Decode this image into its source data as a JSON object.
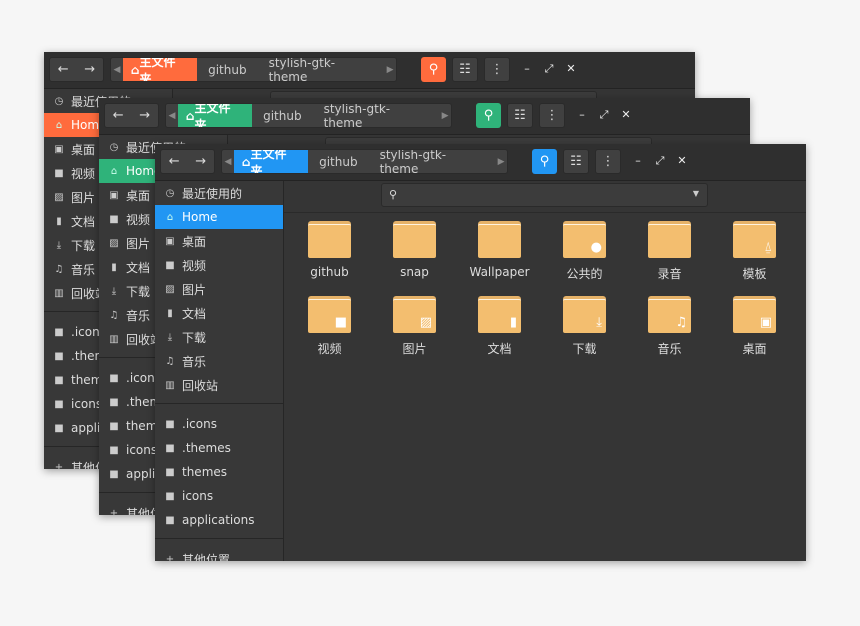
{
  "windows": [
    {
      "accent": "#ff6b3d",
      "nav": {
        "back": "←",
        "forward": "→"
      },
      "breadcrumbs": [
        "主文件夹",
        "github",
        "stylish-gtk-theme"
      ]
    },
    {
      "accent": "#2fb37a",
      "nav": {
        "back": "←",
        "forward": "→"
      },
      "breadcrumbs": [
        "主文件夹",
        "github",
        "stylish-gtk-theme"
      ]
    },
    {
      "accent": "#2196f3",
      "nav": {
        "back": "←",
        "forward": "→"
      },
      "breadcrumbs": [
        "主文件夹",
        "github",
        "stylish-gtk-theme"
      ]
    }
  ],
  "window_controls": {
    "minimize": "–",
    "maximize": "⤢",
    "close": "✕"
  },
  "sidebar": {
    "places": [
      {
        "label": "最近使用的",
        "icon": "clock-icon"
      },
      {
        "label": "Home",
        "icon": "home-icon",
        "active": true
      },
      {
        "label": "桌面",
        "icon": "desktop-icon"
      },
      {
        "label": "视频",
        "icon": "video-icon"
      },
      {
        "label": "图片",
        "icon": "image-icon"
      },
      {
        "label": "文档",
        "icon": "document-icon"
      },
      {
        "label": "下载",
        "icon": "download-icon"
      },
      {
        "label": "音乐",
        "icon": "music-icon"
      },
      {
        "label": "回收站",
        "icon": "trash-icon"
      }
    ],
    "bookmarks": [
      {
        "label": ".icons",
        "icon": "folder-icon"
      },
      {
        "label": ".themes",
        "icon": "folder-icon"
      },
      {
        "label": "themes",
        "icon": "folder-icon"
      },
      {
        "label": "icons",
        "icon": "folder-icon"
      },
      {
        "label": "applications",
        "icon": "folder-icon"
      }
    ],
    "other": {
      "label": "其他位置",
      "icon": "plus-icon"
    }
  },
  "files": [
    {
      "name": "github",
      "emblem": ""
    },
    {
      "name": "snap",
      "emblem": ""
    },
    {
      "name": "Wallpaper",
      "emblem": ""
    },
    {
      "name": "公共的",
      "emblem": "user-icon"
    },
    {
      "name": "录音",
      "emblem": ""
    },
    {
      "name": "模板",
      "emblem": "template-icon"
    },
    {
      "name": "视频",
      "emblem": "video-icon"
    },
    {
      "name": "图片",
      "emblem": "image-icon"
    },
    {
      "name": "文档",
      "emblem": "document-icon"
    },
    {
      "name": "下载",
      "emblem": "download-icon"
    },
    {
      "name": "音乐",
      "emblem": "music-icon"
    },
    {
      "name": "桌面",
      "emblem": "desktop-icon"
    }
  ]
}
